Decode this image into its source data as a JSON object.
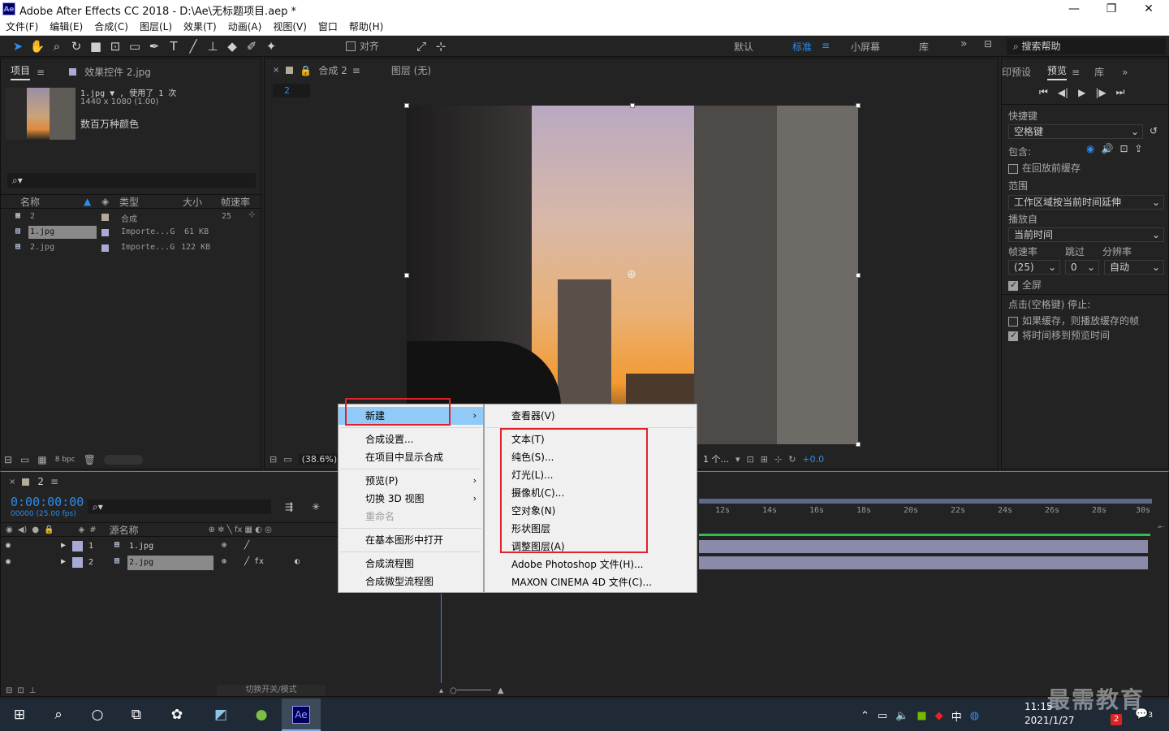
{
  "window": {
    "logo": "Ae",
    "title": "Adobe After Effects CC 2018 - D:\\Ae\\无标题项目.aep *",
    "minimize": "—",
    "maximize": "❐",
    "close": "✕"
  },
  "menubar": [
    "文件(F)",
    "编辑(E)",
    "合成(C)",
    "图层(L)",
    "效果(T)",
    "动画(A)",
    "视图(V)",
    "窗口",
    "帮助(H)"
  ],
  "toolbar": {
    "snap_label": "对齐",
    "workspaces": [
      "默认",
      "标准",
      "小屏幕",
      "库"
    ],
    "active_workspace": "标准",
    "more": "»",
    "search_placeholder": "搜索帮助"
  },
  "project_panel": {
    "tab_project": "项目",
    "tab_effects": "效果控件 2.jpg",
    "selected_name": "1.jpg ▼ , 使用了 1 次",
    "selected_dims": "1440 x 1080 (1.00)",
    "selected_colors": "数百万种颜色",
    "columns": [
      "名称",
      "类型",
      "大小",
      "帧速率"
    ],
    "rows": [
      {
        "name": "2",
        "type": "合成",
        "size": "",
        "fps": "25",
        "color": "#b5a99a"
      },
      {
        "name": "1.jpg",
        "type": "Importe...G",
        "size": "61 KB",
        "fps": "",
        "color": "#a9a9d6"
      },
      {
        "name": "2.jpg",
        "type": "Importe...G",
        "size": "122 KB",
        "fps": "",
        "color": "#a9a9d6"
      }
    ],
    "bpc": "8 bpc"
  },
  "comp_panel": {
    "tab_comp": "合成 2",
    "tab_layer": "图层 (无)",
    "comp_name_tag": "2",
    "zoom": "(38.6%)",
    "view_count": "1 个...",
    "exposure": "+0.0"
  },
  "preview_panel": {
    "tab_presets": "印预设",
    "tab_preview": "预览",
    "tab_lib": "库",
    "shortcut_label": "快捷键",
    "shortcut_value": "空格键",
    "include_label": "包含:",
    "cache_before": "在回放前缓存",
    "range_label": "范围",
    "range_value": "工作区域按当前时间延伸",
    "play_from_label": "播放自",
    "play_from_value": "当前时间",
    "fps_label": "帧速率",
    "skip_label": "跳过",
    "res_label": "分辨率",
    "fps_value": "(25)",
    "skip_value": "0",
    "res_value": "自动",
    "fullscreen": "全屏",
    "stop_label": "点击(空格键) 停止:",
    "if_cached": "如果缓存，则播放缓存的帧",
    "move_time": "将时间移到预览时间"
  },
  "timeline": {
    "tab": "2",
    "timecode": "0:00:00:00",
    "timecode_sub": "00000 (25.00 fps)",
    "col_source": "源名称",
    "layers": [
      {
        "num": "1",
        "name": "1.jpg",
        "color": "#a9a9d6"
      },
      {
        "num": "2",
        "name": "2.jpg",
        "color": "#a9a9d6"
      }
    ],
    "ruler": [
      "12s",
      "14s",
      "16s",
      "18s",
      "20s",
      "22s",
      "24s",
      "26s",
      "28s",
      "30s"
    ],
    "toggle_label": "切换开关/模式"
  },
  "context_menu": {
    "items": [
      {
        "label": "新建",
        "arrow": "›",
        "highlight": true
      },
      {
        "label": "合成设置..."
      },
      {
        "label": "在项目中显示合成"
      },
      {
        "label": "预览(P)",
        "arrow": "›"
      },
      {
        "label": "切换 3D 视图",
        "arrow": "›"
      },
      {
        "label": "重命名",
        "disabled": true
      },
      {
        "label": "在基本图形中打开"
      },
      {
        "label": "合成流程图"
      },
      {
        "label": "合成微型流程图"
      }
    ]
  },
  "submenu": {
    "items": [
      "查看器(V)",
      "文本(T)",
      "纯色(S)...",
      "灯光(L)...",
      "摄像机(C)...",
      "空对象(N)",
      "形状图层",
      "调整图层(A)",
      "Adobe Photoshop 文件(H)...",
      "MAXON CINEMA 4D 文件(C)..."
    ]
  },
  "taskbar": {
    "time": "11:15",
    "date": "2021/1/27",
    "ime": "中",
    "badge": "2",
    "notif": "3",
    "app_ae": "Ae",
    "watermark": "最需教育"
  },
  "colors": {
    "accent": "#2d8ceb",
    "highlight_red": "#e2222a",
    "menu_hl": "#91c9f7"
  }
}
